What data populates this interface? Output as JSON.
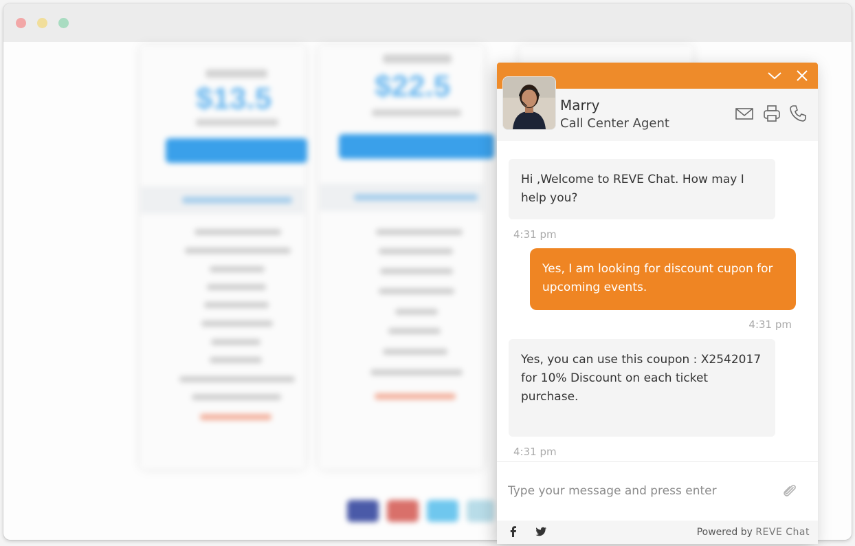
{
  "window": {
    "controls": [
      "close-dot",
      "minimize-dot",
      "zoom-dot"
    ]
  },
  "background": {
    "cards": [
      {
        "price": "$13.5"
      },
      {
        "price": "$22.5"
      }
    ]
  },
  "chat": {
    "header": {
      "controls": [
        "chevron-down-icon",
        "close-icon"
      ]
    },
    "agent": {
      "name": "Marry",
      "role": "Call Center Agent"
    },
    "actions": [
      "mail-icon",
      "print-icon",
      "phone-icon"
    ],
    "messages": [
      {
        "from": "agent",
        "text": "Hi ,Welcome to REVE Chat. How may I help you?",
        "time": "4:31 pm"
      },
      {
        "from": "user",
        "text": "Yes, I am looking for discount cupon for upcoming events.",
        "time": "4:31 pm"
      },
      {
        "from": "agent",
        "text": "Yes, you can use this coupon : X2542017 for 10% Discount on each ticket purchase.",
        "time": "4:31 pm"
      }
    ],
    "input": {
      "placeholder": "Type your message and press enter"
    },
    "footer": {
      "powered_by": "Powered by",
      "brand": "REVE Chat"
    },
    "colors": {
      "accent": "#ee8b2a",
      "user_bubble": "#ef8523",
      "agent_bubble": "#f4f4f4"
    }
  }
}
